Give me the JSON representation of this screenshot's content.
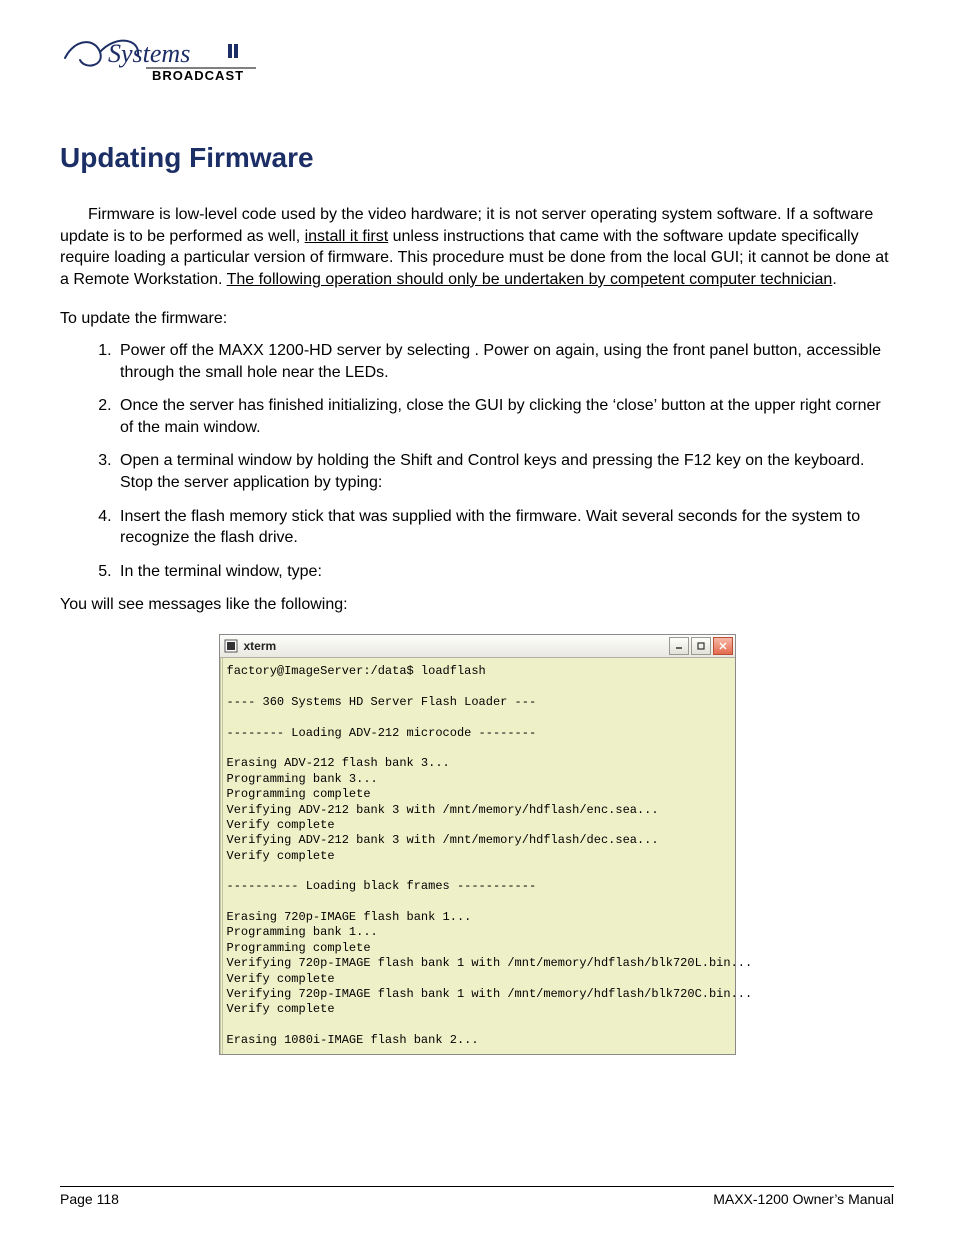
{
  "logo": {
    "alt": "360 Systems Broadcast"
  },
  "heading": "Updating Firmware",
  "intro": {
    "pre": "Firmware is low-level code used by the video hardware; it is not server operating system software.  If a software update is to be performed as well, ",
    "u1": "install it first",
    "mid": " unless instructions that came with the software update specifically require loading a particular version of firmware.  This procedure must be done from the local GUI; it cannot be done at a Remote Workstation. ",
    "u2": "The following operation should only be undertaken by competent computer technician",
    "post": "."
  },
  "lead": "To update the firmware:",
  "steps": [
    "Power off the MAXX 1200-HD server by selecting                                                                              . Power on again, using the front panel              button, accessible through the small hole near the LEDs.",
    "Once the server has finished initializing, close the GUI by clicking the ‘close’ button at the upper right corner of the main window.",
    "Open a terminal window by holding the Shift and Control keys and pressing the F12 key on the keyboard.  Stop the server application by typing:",
    "Insert the flash memory stick that was supplied with the firmware. Wait several seconds for the system to recognize the flash drive.",
    "In the terminal window, type:"
  ],
  "after": "You will see messages like the following:",
  "terminal": {
    "title": "xterm",
    "lines": "factory@ImageServer:/data$ loadflash\n\n---- 360 Systems HD Server Flash Loader ---\n\n-------- Loading ADV-212 microcode --------\n\nErasing ADV-212 flash bank 3...\nProgramming bank 3...\nProgramming complete\nVerifying ADV-212 bank 3 with /mnt/memory/hdflash/enc.sea...\nVerify complete\nVerifying ADV-212 bank 3 with /mnt/memory/hdflash/dec.sea...\nVerify complete\n\n---------- Loading black frames -----------\n\nErasing 720p-IMAGE flash bank 1...\nProgramming bank 1...\nProgramming complete\nVerifying 720p-IMAGE flash bank 1 with /mnt/memory/hdflash/blk720L.bin...\nVerify complete\nVerifying 720p-IMAGE flash bank 1 with /mnt/memory/hdflash/blk720C.bin...\nVerify complete\n\nErasing 1080i-IMAGE flash bank 2..."
  },
  "footer": {
    "left": "Page 118",
    "right": "MAXX-1200 Owner’s Manual"
  }
}
